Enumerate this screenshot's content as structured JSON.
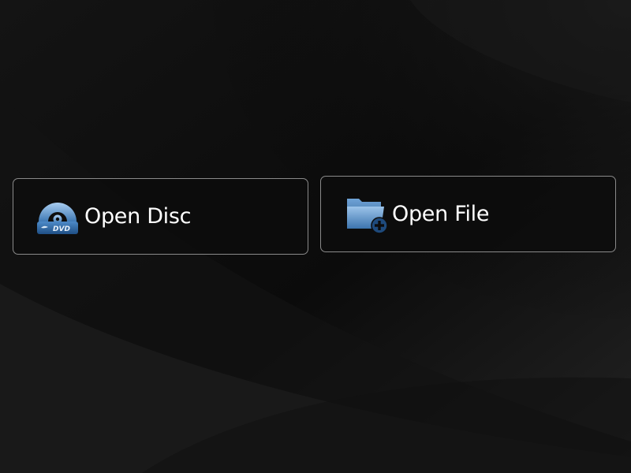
{
  "screen": {
    "background_color": "#0c0c0c"
  },
  "actions": {
    "open_disc": {
      "label": "Open Disc",
      "icon": "disc-icon",
      "icon_text": "DVD"
    },
    "open_file": {
      "label": "Open File",
      "icon": "folder-add-icon"
    }
  },
  "colors": {
    "button_border": "#8a8a8a",
    "label": "#ffffff",
    "icon_blue": "#5b9bd5"
  }
}
